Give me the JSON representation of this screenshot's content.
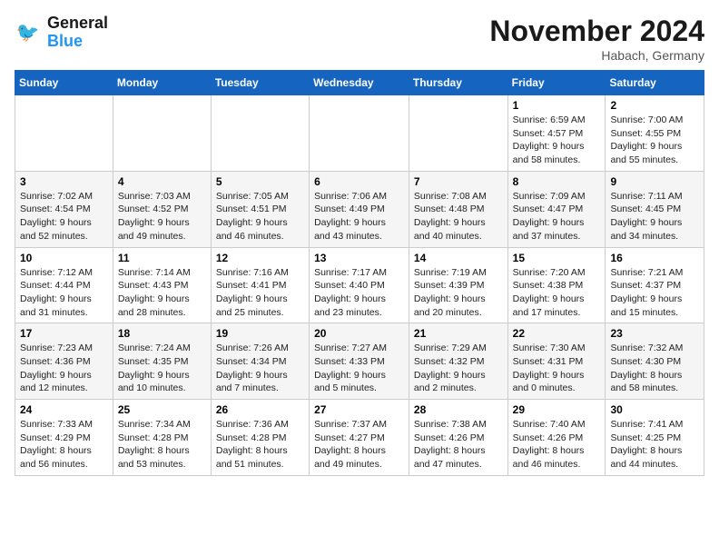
{
  "header": {
    "logo_line1": "General",
    "logo_line2": "Blue",
    "month_title": "November 2024",
    "location": "Habach, Germany"
  },
  "weekdays": [
    "Sunday",
    "Monday",
    "Tuesday",
    "Wednesday",
    "Thursday",
    "Friday",
    "Saturday"
  ],
  "weeks": [
    [
      {
        "day": "",
        "info": ""
      },
      {
        "day": "",
        "info": ""
      },
      {
        "day": "",
        "info": ""
      },
      {
        "day": "",
        "info": ""
      },
      {
        "day": "",
        "info": ""
      },
      {
        "day": "1",
        "info": "Sunrise: 6:59 AM\nSunset: 4:57 PM\nDaylight: 9 hours and 58 minutes."
      },
      {
        "day": "2",
        "info": "Sunrise: 7:00 AM\nSunset: 4:55 PM\nDaylight: 9 hours and 55 minutes."
      }
    ],
    [
      {
        "day": "3",
        "info": "Sunrise: 7:02 AM\nSunset: 4:54 PM\nDaylight: 9 hours and 52 minutes."
      },
      {
        "day": "4",
        "info": "Sunrise: 7:03 AM\nSunset: 4:52 PM\nDaylight: 9 hours and 49 minutes."
      },
      {
        "day": "5",
        "info": "Sunrise: 7:05 AM\nSunset: 4:51 PM\nDaylight: 9 hours and 46 minutes."
      },
      {
        "day": "6",
        "info": "Sunrise: 7:06 AM\nSunset: 4:49 PM\nDaylight: 9 hours and 43 minutes."
      },
      {
        "day": "7",
        "info": "Sunrise: 7:08 AM\nSunset: 4:48 PM\nDaylight: 9 hours and 40 minutes."
      },
      {
        "day": "8",
        "info": "Sunrise: 7:09 AM\nSunset: 4:47 PM\nDaylight: 9 hours and 37 minutes."
      },
      {
        "day": "9",
        "info": "Sunrise: 7:11 AM\nSunset: 4:45 PM\nDaylight: 9 hours and 34 minutes."
      }
    ],
    [
      {
        "day": "10",
        "info": "Sunrise: 7:12 AM\nSunset: 4:44 PM\nDaylight: 9 hours and 31 minutes."
      },
      {
        "day": "11",
        "info": "Sunrise: 7:14 AM\nSunset: 4:43 PM\nDaylight: 9 hours and 28 minutes."
      },
      {
        "day": "12",
        "info": "Sunrise: 7:16 AM\nSunset: 4:41 PM\nDaylight: 9 hours and 25 minutes."
      },
      {
        "day": "13",
        "info": "Sunrise: 7:17 AM\nSunset: 4:40 PM\nDaylight: 9 hours and 23 minutes."
      },
      {
        "day": "14",
        "info": "Sunrise: 7:19 AM\nSunset: 4:39 PM\nDaylight: 9 hours and 20 minutes."
      },
      {
        "day": "15",
        "info": "Sunrise: 7:20 AM\nSunset: 4:38 PM\nDaylight: 9 hours and 17 minutes."
      },
      {
        "day": "16",
        "info": "Sunrise: 7:21 AM\nSunset: 4:37 PM\nDaylight: 9 hours and 15 minutes."
      }
    ],
    [
      {
        "day": "17",
        "info": "Sunrise: 7:23 AM\nSunset: 4:36 PM\nDaylight: 9 hours and 12 minutes."
      },
      {
        "day": "18",
        "info": "Sunrise: 7:24 AM\nSunset: 4:35 PM\nDaylight: 9 hours and 10 minutes."
      },
      {
        "day": "19",
        "info": "Sunrise: 7:26 AM\nSunset: 4:34 PM\nDaylight: 9 hours and 7 minutes."
      },
      {
        "day": "20",
        "info": "Sunrise: 7:27 AM\nSunset: 4:33 PM\nDaylight: 9 hours and 5 minutes."
      },
      {
        "day": "21",
        "info": "Sunrise: 7:29 AM\nSunset: 4:32 PM\nDaylight: 9 hours and 2 minutes."
      },
      {
        "day": "22",
        "info": "Sunrise: 7:30 AM\nSunset: 4:31 PM\nDaylight: 9 hours and 0 minutes."
      },
      {
        "day": "23",
        "info": "Sunrise: 7:32 AM\nSunset: 4:30 PM\nDaylight: 8 hours and 58 minutes."
      }
    ],
    [
      {
        "day": "24",
        "info": "Sunrise: 7:33 AM\nSunset: 4:29 PM\nDaylight: 8 hours and 56 minutes."
      },
      {
        "day": "25",
        "info": "Sunrise: 7:34 AM\nSunset: 4:28 PM\nDaylight: 8 hours and 53 minutes."
      },
      {
        "day": "26",
        "info": "Sunrise: 7:36 AM\nSunset: 4:28 PM\nDaylight: 8 hours and 51 minutes."
      },
      {
        "day": "27",
        "info": "Sunrise: 7:37 AM\nSunset: 4:27 PM\nDaylight: 8 hours and 49 minutes."
      },
      {
        "day": "28",
        "info": "Sunrise: 7:38 AM\nSunset: 4:26 PM\nDaylight: 8 hours and 47 minutes."
      },
      {
        "day": "29",
        "info": "Sunrise: 7:40 AM\nSunset: 4:26 PM\nDaylight: 8 hours and 46 minutes."
      },
      {
        "day": "30",
        "info": "Sunrise: 7:41 AM\nSunset: 4:25 PM\nDaylight: 8 hours and 44 minutes."
      }
    ]
  ]
}
